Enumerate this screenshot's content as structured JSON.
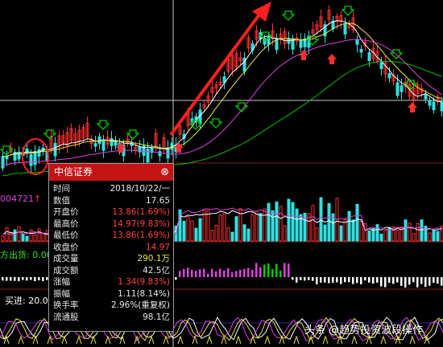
{
  "panel": {
    "title": "中信证券",
    "close_glyph": "⊗",
    "rows": [
      {
        "label": "时间",
        "value": "2018/10/22/一",
        "color": "#e8e8e8"
      },
      {
        "label": "数值",
        "value": "17.65",
        "color": "#e8e8e8"
      },
      {
        "label": "开盘价",
        "value": "13.86(1.69%)",
        "color": "#ff4040"
      },
      {
        "label": "最高价",
        "value": "14.97(9.83%)",
        "color": "#ff4040"
      },
      {
        "label": "最低价",
        "value": "13.86(1.69%)",
        "color": "#ff4040"
      },
      {
        "label": "收盘价",
        "value": "14.97",
        "color": "#ff4040"
      },
      {
        "label": "成交量",
        "value": "290.1万",
        "color": "#e8e83c"
      },
      {
        "label": "成交额",
        "value": "42.5亿",
        "color": "#e8e8e8"
      },
      {
        "label": "涨幅",
        "value": "1.34(9.83%)",
        "color": "#ff4040"
      },
      {
        "label": "振幅",
        "value": "1.11(8.14%)",
        "color": "#e8e8e8"
      },
      {
        "label": "换手率",
        "value": "2.96%(重复权)",
        "color": "#e8e8e8"
      },
      {
        "label": "流通股",
        "value": "98.1亿",
        "color": "#e8e8e8"
      }
    ]
  },
  "side_labels": {
    "code": "004721",
    "code_arrow": "↑",
    "out_label": "方出货: 0.00",
    "buy_label": "买进: 20.0"
  },
  "watermark": "头条 @趋势投资波段操作",
  "colors": {
    "up": "#ff3030",
    "down": "#30e0e0",
    "signal_green": "#00cc00",
    "ma_white": "#ffffff",
    "ma_yellow": "#e8e83c",
    "ma_magenta": "#e040e0",
    "ma_green": "#00c000"
  }
}
